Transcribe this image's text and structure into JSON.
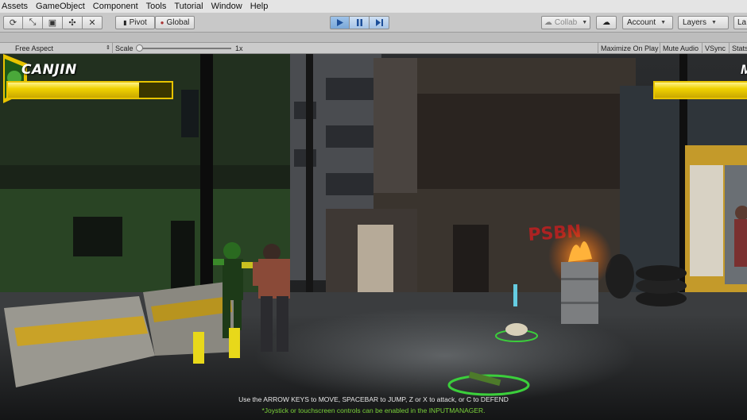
{
  "menu": [
    "Assets",
    "GameObject",
    "Component",
    "Tools",
    "Tutorial",
    "Window",
    "Help"
  ],
  "toolbar": {
    "transform_tools": [
      "rotate-tool-icon",
      "move-tool-icon",
      "rect-tool-icon",
      "transform-tool-icon",
      "custom-tool-icon"
    ],
    "pivot_label": "Pivot",
    "global_label": "Global",
    "collab_label": "Collab",
    "account_label": "Account",
    "layers_label": "Layers",
    "layout_label": "La",
    "play_state": "playing"
  },
  "gameview": {
    "aspect_label": "Free Aspect",
    "scale_label": "Scale",
    "scale_value": "1x",
    "maximize_label": "Maximize On Play",
    "mute_label": "Mute Audio",
    "vsync_label": "VSync",
    "stats_label": "Stats"
  },
  "hud": {
    "player1_name": "CANJIN",
    "player1_health": 0.8,
    "player2_name": "M"
  },
  "graffiti": "PSBN",
  "instructions": {
    "line1": "Use the ARROW KEYS to MOVE, SPACEBAR to JUMP, Z or X to attack, or C to DEFEND",
    "line2": "*Joystick or touchscreen controls can be enabled in the INPUTMANAGER."
  },
  "colors": {
    "play_active": "#7aa8d8",
    "health_yellow": "#f0d200",
    "hint_green": "#7bd23a"
  }
}
